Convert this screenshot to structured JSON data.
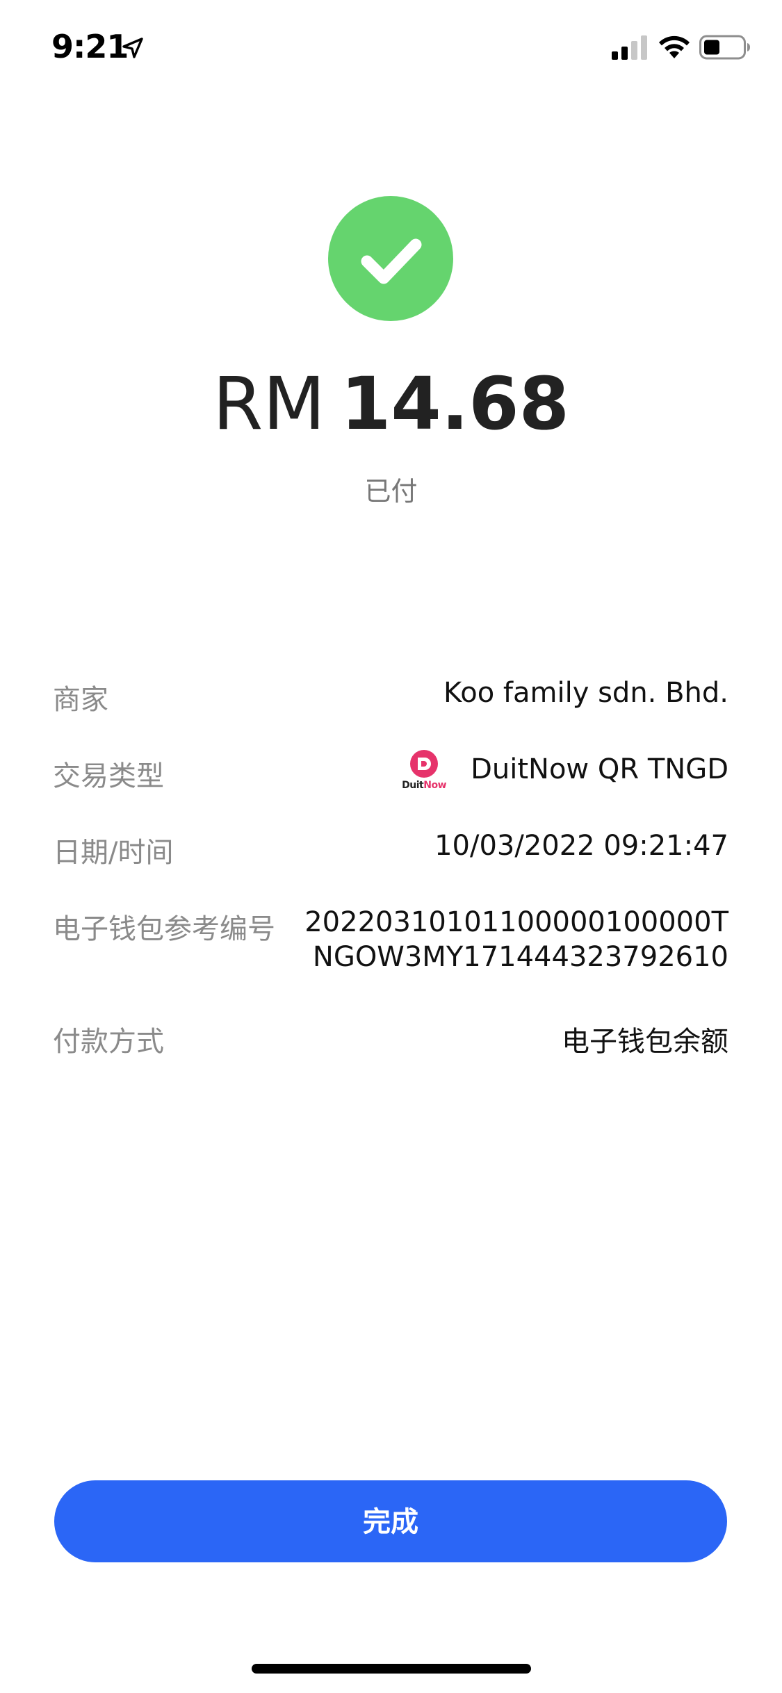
{
  "status_bar": {
    "time": "9:21"
  },
  "payment": {
    "currency": "RM",
    "amount": "14.68",
    "status": "已付"
  },
  "details": {
    "merchant_label": "商家",
    "merchant_value": "Koo family sdn. Bhd.",
    "type_label": "交易类型",
    "type_value": "DuitNow QR TNGD",
    "type_logo_text_a": "Duit",
    "type_logo_text_b": "Now",
    "datetime_label": "日期/时间",
    "datetime_value": "10/03/2022 09:21:47",
    "reference_label": "电子钱包参考编号",
    "reference_line1": "20220310101100000100000T",
    "reference_line2": "NGOW3MY171444323792610",
    "method_label": "付款方式",
    "method_value": "电子钱包余额"
  },
  "actions": {
    "done_label": "完成"
  },
  "colors": {
    "success_green": "#65d46e",
    "primary_blue": "#2b66f6",
    "duitnow_pink": "#e6336b",
    "label_gray": "#8a8a8a"
  },
  "icons": {
    "status": [
      "location-arrow-icon",
      "cellular-signal-icon",
      "wifi-icon",
      "battery-icon"
    ],
    "success": "checkmark-icon",
    "payment_type": "duitnow-logo-icon"
  }
}
